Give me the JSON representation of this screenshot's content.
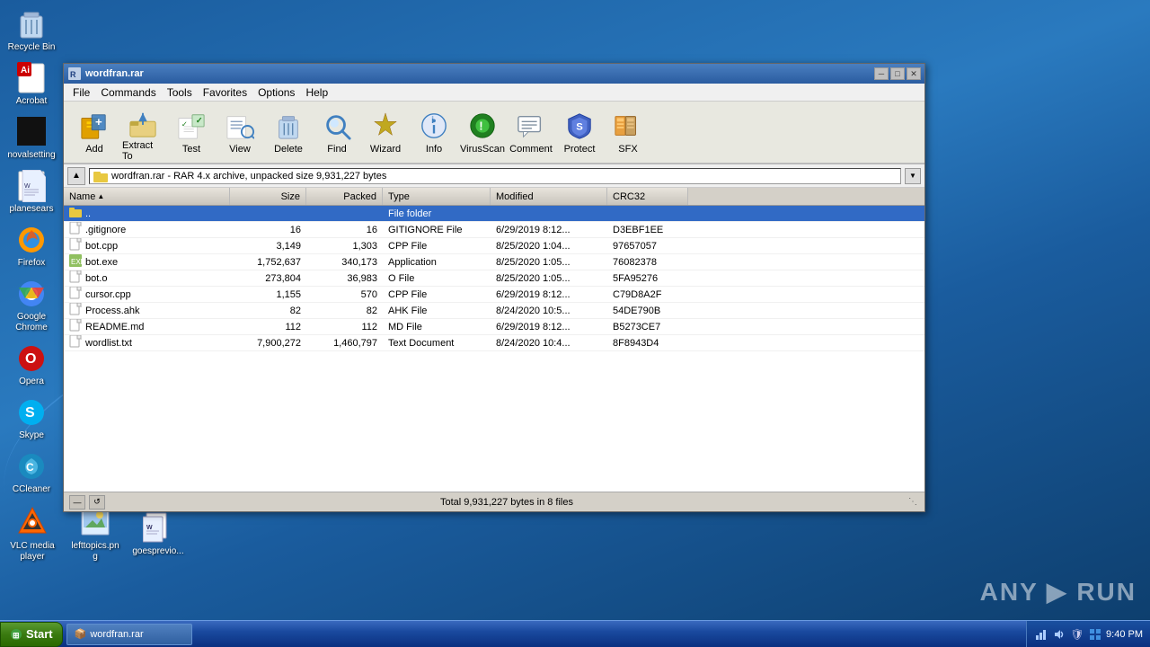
{
  "desktop": {
    "icons_left": [
      {
        "id": "recycle-bin",
        "label": "Recycle Bin",
        "symbol": "🗑"
      },
      {
        "id": "acrobat",
        "label": "Acrobat",
        "symbol": "📄"
      },
      {
        "id": "novelsetting",
        "label": "novalsetting",
        "symbol": "⬛"
      },
      {
        "id": "planesears",
        "label": "planesears",
        "symbol": "📝"
      },
      {
        "id": "firefox",
        "label": "Firefox",
        "symbol": "🦊"
      },
      {
        "id": "google-chrome",
        "label": "Google Chrome",
        "symbol": "🌐"
      },
      {
        "id": "opera",
        "label": "Opera",
        "symbol": "O"
      },
      {
        "id": "skype",
        "label": "Skype",
        "symbol": "S"
      },
      {
        "id": "ccleaner",
        "label": "CCleaner",
        "symbol": "C"
      }
    ],
    "bottom_icons": [
      {
        "id": "vlc",
        "label": "VLC media player",
        "symbol": "🔶"
      },
      {
        "id": "lefttopics",
        "label": "lefttopics.png",
        "symbol": "🖼"
      },
      {
        "id": "goesprevio",
        "label": "goesprevio...",
        "symbol": "📝"
      }
    ],
    "watermark": "ANY ▶ RUN"
  },
  "winrar": {
    "title": "wordfran.rar",
    "title_full": "wordfran.rar",
    "menu": [
      "File",
      "Commands",
      "Tools",
      "Favorites",
      "Options",
      "Help"
    ],
    "toolbar": [
      {
        "id": "add",
        "label": "Add",
        "symbol": "📦"
      },
      {
        "id": "extract-to",
        "label": "Extract To",
        "symbol": "📂"
      },
      {
        "id": "test",
        "label": "Test",
        "symbol": "✅"
      },
      {
        "id": "view",
        "label": "View",
        "symbol": "🔍"
      },
      {
        "id": "delete",
        "label": "Delete",
        "symbol": "🗑"
      },
      {
        "id": "find",
        "label": "Find",
        "symbol": "🔎"
      },
      {
        "id": "wizard",
        "label": "Wizard",
        "symbol": "✨"
      },
      {
        "id": "info",
        "label": "Info",
        "symbol": "ℹ"
      },
      {
        "id": "virusscan",
        "label": "VirusScan",
        "symbol": "🛡"
      },
      {
        "id": "comment",
        "label": "Comment",
        "symbol": "💬"
      },
      {
        "id": "protect",
        "label": "Protect",
        "symbol": "🔒"
      },
      {
        "id": "sfx",
        "label": "SFX",
        "symbol": "⚙"
      }
    ],
    "address_bar": {
      "path": " wordfran.rar - RAR 4.x archive, unpacked size 9,931,227 bytes",
      "icon": "📁"
    },
    "columns": [
      "Name",
      "Size",
      "Packed",
      "Type",
      "Modified",
      "CRC32"
    ],
    "files": [
      {
        "name": "..",
        "size": "",
        "packed": "",
        "type": "File folder",
        "modified": "",
        "crc32": "",
        "icon": "folder",
        "selected": true
      },
      {
        "name": ".gitignore",
        "size": "16",
        "packed": "16",
        "type": "GITIGNORE File",
        "modified": "6/29/2019 8:12...",
        "crc32": "D3EBF1EE",
        "icon": "file"
      },
      {
        "name": "bot.cpp",
        "size": "3,149",
        "packed": "1,303",
        "type": "CPP File",
        "modified": "8/25/2020 1:04...",
        "crc32": "97657057",
        "icon": "file"
      },
      {
        "name": "bot.exe",
        "size": "1,752,637",
        "packed": "340,173",
        "type": "Application",
        "modified": "8/25/2020 1:05...",
        "crc32": "76082378",
        "icon": "exe"
      },
      {
        "name": "bot.o",
        "size": "273,804",
        "packed": "36,983",
        "type": "O File",
        "modified": "8/25/2020 1:05...",
        "crc32": "5FA95276",
        "icon": "file"
      },
      {
        "name": "cursor.cpp",
        "size": "1,155",
        "packed": "570",
        "type": "CPP File",
        "modified": "6/29/2019 8:12...",
        "crc32": "C79D8A2F",
        "icon": "file"
      },
      {
        "name": "Process.ahk",
        "size": "82",
        "packed": "82",
        "type": "AHK File",
        "modified": "8/24/2020 10:5...",
        "crc32": "54DE790B",
        "icon": "file"
      },
      {
        "name": "README.md",
        "size": "112",
        "packed": "112",
        "type": "MD File",
        "modified": "6/29/2019 8:12...",
        "crc32": "B5273CE7",
        "icon": "file"
      },
      {
        "name": "wordlist.txt",
        "size": "7,900,272",
        "packed": "1,460,797",
        "type": "Text Document",
        "modified": "8/24/2020 10:4...",
        "crc32": "8F8943D4",
        "icon": "file"
      }
    ],
    "status": "Total 9,931,227 bytes in 8 files",
    "title_buttons": [
      "─",
      "□",
      "✕"
    ]
  },
  "taskbar": {
    "start_label": "Start",
    "items": [
      {
        "id": "winrar-task",
        "label": "wordfran.rar",
        "icon": "📦"
      }
    ],
    "tray_icons": [
      "🔊",
      "🌐",
      "🛡",
      "⚠"
    ],
    "time": "9:40 PM"
  }
}
